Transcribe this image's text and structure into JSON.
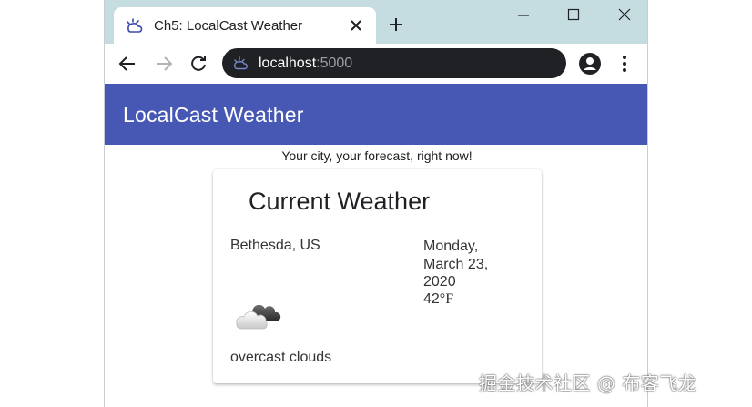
{
  "browser": {
    "tab_title": "Ch5: LocalCast Weather",
    "url_host": "localhost",
    "url_port": ":5000"
  },
  "app": {
    "title": "LocalCast Weather",
    "tagline": "Your city, your forecast, right now!",
    "card_title": "Current Weather",
    "city": "Bethesda, US",
    "date_lines": [
      "Monday,",
      "March 23,",
      "2020"
    ],
    "temperature_value": "42",
    "temperature_unit": "°F",
    "description": "overcast clouds",
    "icon": "overcast-clouds-icon"
  },
  "colors": {
    "tab_strip": "#c5dde0",
    "app_toolbar": "#4758b4",
    "omnibox": "#202124"
  },
  "watermark": "掘金技术社区 @ 布客飞龙"
}
